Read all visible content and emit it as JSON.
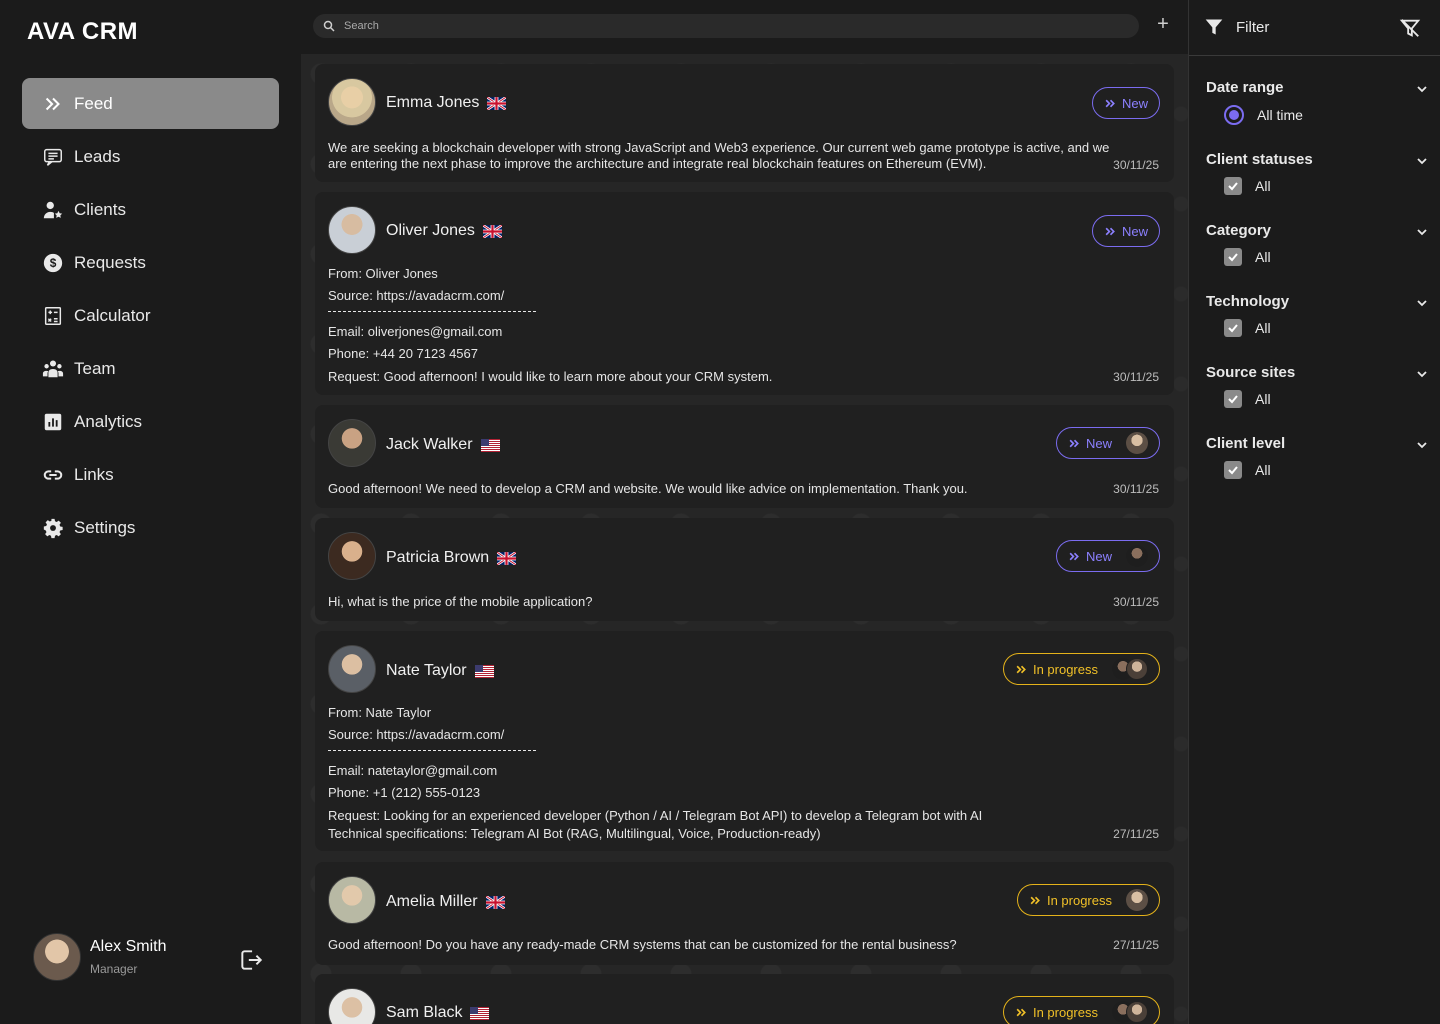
{
  "app": {
    "logo": "AVA CRM"
  },
  "nav": [
    {
      "label": "Feed",
      "icon": "chevrons-right-icon",
      "active": true
    },
    {
      "label": "Leads",
      "icon": "message-list-icon"
    },
    {
      "label": "Clients",
      "icon": "user-star-icon"
    },
    {
      "label": "Requests",
      "icon": "dollar-circle-icon"
    },
    {
      "label": "Calculator",
      "icon": "calculator-icon"
    },
    {
      "label": "Team",
      "icon": "team-icon"
    },
    {
      "label": "Analytics",
      "icon": "bar-chart-icon"
    },
    {
      "label": "Links",
      "icon": "link-icon"
    },
    {
      "label": "Settings",
      "icon": "gear-icon"
    }
  ],
  "user": {
    "name": "Alex Smith",
    "role": "Manager"
  },
  "search": {
    "placeholder": "Search"
  },
  "cards": [
    {
      "name": "Emma Jones",
      "flag": "uk",
      "status": "New",
      "text": "We are seeking a blockchain developer with strong JavaScript and Web3 experience. Our current web game prototype is active, and we are entering the next phase to improve the architecture and integrate real blockchain features on Ethereum (EVM).",
      "date": "30/11/25"
    },
    {
      "name": "Oliver Jones",
      "flag": "uk",
      "status": "New",
      "from": "From: Oliver Jones",
      "source": "Source: https://avadacrm.com/",
      "email": "Email: oliverjones@gmail.com",
      "phone": "Phone: +44 20 7123 4567",
      "request": "Request: Good afternoon! I would like to learn more about your CRM system.",
      "date": "30/11/25"
    },
    {
      "name": "Jack Walker",
      "flag": "us",
      "status": "New",
      "text": "Good afternoon! We need to develop a CRM and website. We would like advice on implementation. Thank you.",
      "date": "30/11/25"
    },
    {
      "name": "Patricia Brown",
      "flag": "uk",
      "status": "New",
      "text": "Hi, what is the price of the mobile application?",
      "date": "30/11/25"
    },
    {
      "name": "Nate Taylor",
      "flag": "us",
      "status": "In progress",
      "from": "From: Nate Taylor",
      "source": "Source: https://avadacrm.com/",
      "email": "Email: natetaylor@gmail.com",
      "phone": "Phone: +1 (212) 555-0123",
      "request": "Request: Looking for an experienced developer (Python / AI / Telegram Bot API) to develop a Telegram bot with AI",
      "request2": "Technical specifications: Telegram AI Bot (RAG, Multilingual, Voice, Production-ready)",
      "date": "27/11/25"
    },
    {
      "name": "Amelia Miller",
      "flag": "uk",
      "status": "In progress",
      "text": "Good afternoon! Do you have any ready-made CRM systems that can be customized for the rental business?",
      "date": "27/11/25"
    },
    {
      "name": "Sam Black",
      "flag": "us",
      "status": "In progress"
    }
  ],
  "filter": {
    "title": "Filter",
    "groups": [
      {
        "title": "Date range",
        "option": "All time",
        "type": "radio"
      },
      {
        "title": "Client statuses",
        "option": "All",
        "type": "checkbox"
      },
      {
        "title": "Category",
        "option": "All",
        "type": "checkbox"
      },
      {
        "title": "Technology",
        "option": "All",
        "type": "checkbox"
      },
      {
        "title": "Source sites",
        "option": "All",
        "type": "checkbox"
      },
      {
        "title": "Client level",
        "option": "All",
        "type": "checkbox"
      }
    ]
  },
  "colors": {
    "accent_new": "#7b6cf0",
    "accent_progress": "#e4b21a",
    "active_nav": "#8a8a8a"
  }
}
